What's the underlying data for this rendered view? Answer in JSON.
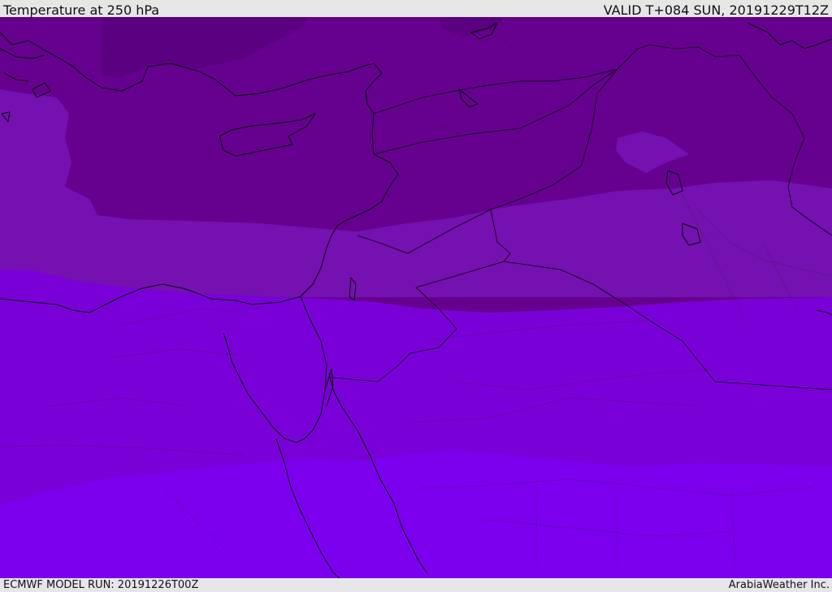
{
  "header": {
    "title": "Temperature at 250 hPa",
    "valid_time": "VALID T+084 SUN, 20191229T12Z"
  },
  "footer": {
    "model_run": "ECMWF MODEL RUN: 20191226T00Z",
    "credit": "ArabiaWeather Inc."
  },
  "map": {
    "field": "temperature",
    "level": "250 hPa",
    "color_bands": [
      "#5a0080",
      "#65008f",
      "#7411b0",
      "#7a00d8",
      "#7c00ee"
    ]
  }
}
